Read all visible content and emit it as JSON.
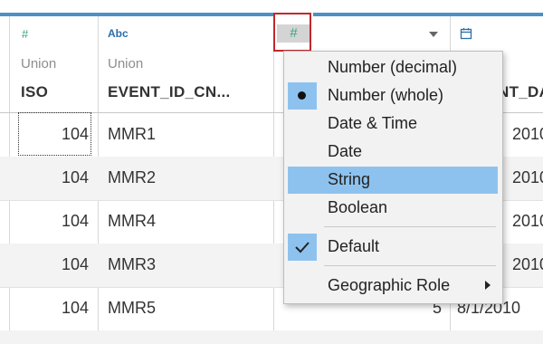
{
  "columns": [
    {
      "icon": "#",
      "icon_name": "number-icon",
      "source": "Union",
      "name": "ISO"
    },
    {
      "icon": "Abc",
      "icon_name": "string-type-icon",
      "source": "Union",
      "name": "EVENT_ID_CN..."
    },
    {
      "icon": "#",
      "icon_name": "number-icon",
      "source": "",
      "name": ""
    },
    {
      "icon": "",
      "icon_name": "calendar-icon",
      "source": "",
      "name": "NT_DA"
    }
  ],
  "rows": [
    {
      "iso": "104",
      "event_id": "MMR1",
      "c3": "",
      "date": "2010"
    },
    {
      "iso": "104",
      "event_id": "MMR2",
      "c3": "",
      "date": "2010"
    },
    {
      "iso": "104",
      "event_id": "MMR4",
      "c3": "",
      "date": "2010"
    },
    {
      "iso": "104",
      "event_id": "MMR3",
      "c3": "",
      "date": "2010"
    },
    {
      "iso": "104",
      "event_id": "MMR5",
      "c3": "5",
      "date": "8/1/2010"
    }
  ],
  "menu": {
    "items": [
      {
        "label": "Number (decimal)"
      },
      {
        "label": "Number (whole)",
        "checked": "dot"
      },
      {
        "label": "Date & Time"
      },
      {
        "label": "Date"
      },
      {
        "label": "String",
        "highlighted": true
      },
      {
        "label": "Boolean"
      },
      {
        "label": "Default",
        "checked": "check"
      },
      {
        "label": "Geographic Role",
        "submenu": true
      }
    ]
  },
  "colors": {
    "accent": "#4e90c4",
    "highlight": "#8ec2ee",
    "number_icon": "#3aa37a",
    "string_icon": "#2b6ea8",
    "focus_box": "#c0292b"
  }
}
